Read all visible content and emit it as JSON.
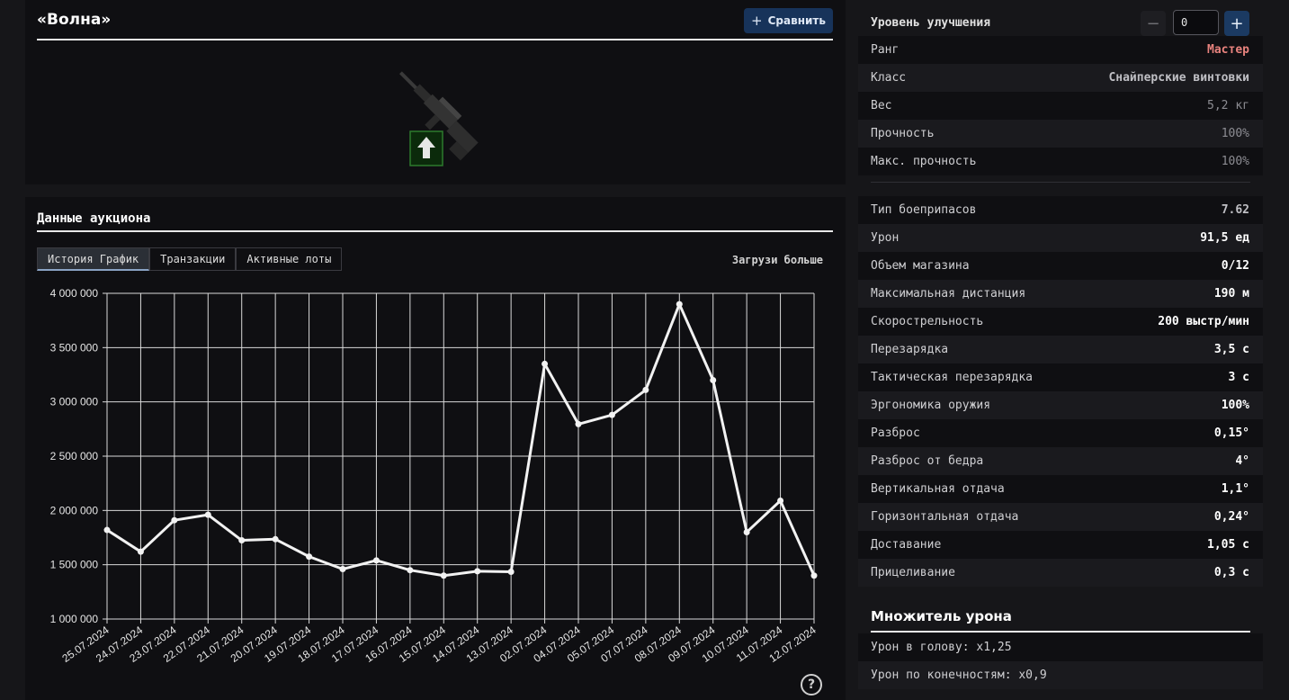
{
  "item": {
    "title": "«Волна»",
    "compare_label": "Сравнить"
  },
  "auction": {
    "title": "Данные аукциона",
    "tabs": [
      {
        "label": "История График",
        "active": true
      },
      {
        "label": "Транзакции",
        "active": false
      },
      {
        "label": "Активные лоты",
        "active": false
      }
    ],
    "load_more": "Загрузи больше",
    "help": "?"
  },
  "chart_data": {
    "type": "line",
    "categories": [
      "25.07.2024",
      "24.07.2024",
      "23.07.2024",
      "22.07.2024",
      "21.07.2024",
      "20.07.2024",
      "19.07.2024",
      "18.07.2024",
      "17.07.2024",
      "16.07.2024",
      "15.07.2024",
      "14.07.2024",
      "13.07.2024",
      "02.07.2024",
      "04.07.2024",
      "05.07.2024",
      "07.07.2024",
      "08.07.2024",
      "09.07.2024",
      "10.07.2024",
      "11.07.2024",
      "12.07.2024"
    ],
    "values": [
      1820000,
      1620000,
      1910000,
      1960000,
      1725000,
      1735000,
      1575000,
      1460000,
      1540000,
      1450000,
      1400000,
      1440000,
      1435000,
      3350000,
      2795000,
      2880000,
      3110000,
      3900000,
      3200000,
      1800000,
      2090000,
      1400000
    ],
    "ylim": [
      1000000,
      4000000
    ],
    "yticks": [
      {
        "value": 1000000,
        "label": "1 000 000"
      },
      {
        "value": 1500000,
        "label": "1 500 000"
      },
      {
        "value": 2000000,
        "label": "2 000 000"
      },
      {
        "value": 2500000,
        "label": "2 500 000"
      },
      {
        "value": 3000000,
        "label": "3 000 000"
      },
      {
        "value": 3500000,
        "label": "3 500 000"
      },
      {
        "value": 4000000,
        "label": "4 000 000"
      }
    ],
    "grid": true,
    "line_color": "#f2f2f2",
    "grid_color": "#d9d9d9"
  },
  "stats": {
    "upgrade_label": "Уровень улучшения",
    "upgrade_value": "0",
    "rows_top": [
      {
        "label": "Ранг",
        "value": "Мастер",
        "style": "rank"
      },
      {
        "label": "Класс",
        "value": "Снайперские винтовки",
        "style": "dim"
      },
      {
        "label": "Вес",
        "value": "5,2 кг",
        "style": "muted"
      },
      {
        "label": "Прочность",
        "value": "100%",
        "style": "muted"
      },
      {
        "label": "Макс. прочность",
        "value": "100%",
        "style": "muted"
      }
    ],
    "rows_bottom": [
      {
        "label": "Тип боеприпасов",
        "value": "7.62",
        "style": "dim"
      },
      {
        "label": "Урон",
        "value": "91,5 ед",
        "style": ""
      },
      {
        "label": "Объем магазина",
        "value": "0/12",
        "style": ""
      },
      {
        "label": "Максимальная дистанция",
        "value": "190 м",
        "style": ""
      },
      {
        "label": "Скорострельность",
        "value": "200 выстр/мин",
        "style": ""
      },
      {
        "label": "Перезарядка",
        "value": "3,5 с",
        "style": ""
      },
      {
        "label": "Тактическая перезарядка",
        "value": "3 с",
        "style": ""
      },
      {
        "label": "Эргономика оружия",
        "value": "100%",
        "style": ""
      },
      {
        "label": "Разброс",
        "value": "0,15°",
        "style": ""
      },
      {
        "label": "Разброс от бедра",
        "value": "4°",
        "style": ""
      },
      {
        "label": "Вертикальная отдача",
        "value": "1,1°",
        "style": ""
      },
      {
        "label": "Горизонтальная отдача",
        "value": "0,24°",
        "style": ""
      },
      {
        "label": "Доставание",
        "value": "1,05 с",
        "style": ""
      },
      {
        "label": "Прицеливание",
        "value": "0,3 с",
        "style": ""
      }
    ],
    "multiplier_title": "Множитель урона",
    "multiplier_rows": [
      {
        "label": "Урон в голову: x1,25"
      },
      {
        "label": "Урон по конечностям: x0,9"
      }
    ]
  }
}
